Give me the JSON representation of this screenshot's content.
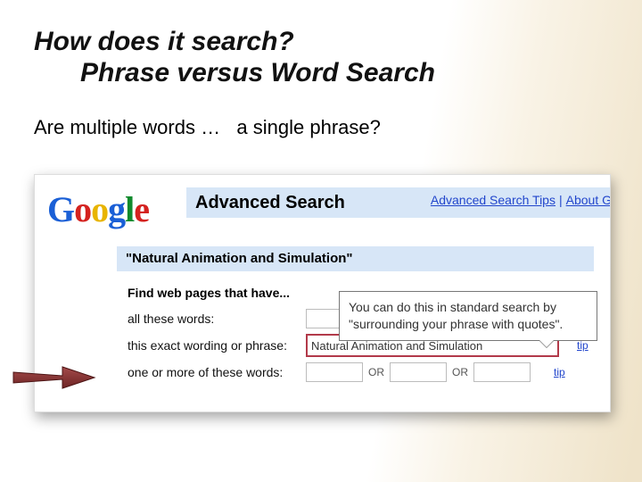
{
  "slide": {
    "title_line1": "How does it search?",
    "title_line2": "Phrase versus Word Search",
    "body_text": "Are multiple words …   a single phrase?"
  },
  "logo": {
    "g": "G",
    "o1": "o",
    "o2": "o",
    "g2": "g",
    "l": "l",
    "e": "e"
  },
  "adv": {
    "header": "Advanced Search",
    "tips_link": "Advanced Search Tips",
    "about_link": "About G",
    "query_display": "\"Natural Animation and Simulation\"",
    "section_label": "Find web pages that have...",
    "row_all": "all these words:",
    "row_exact": "this exact wording or phrase:",
    "row_or": "one or more of these words:",
    "phrase_value": "Natural Animation and Simulation",
    "or_label_1": "OR",
    "or_label_2": "OR",
    "tip_label_1": "tip",
    "tip_label_2": "tip"
  },
  "callout": {
    "text": "You can do this in standard search by \"surrounding your phrase with quotes\"."
  }
}
